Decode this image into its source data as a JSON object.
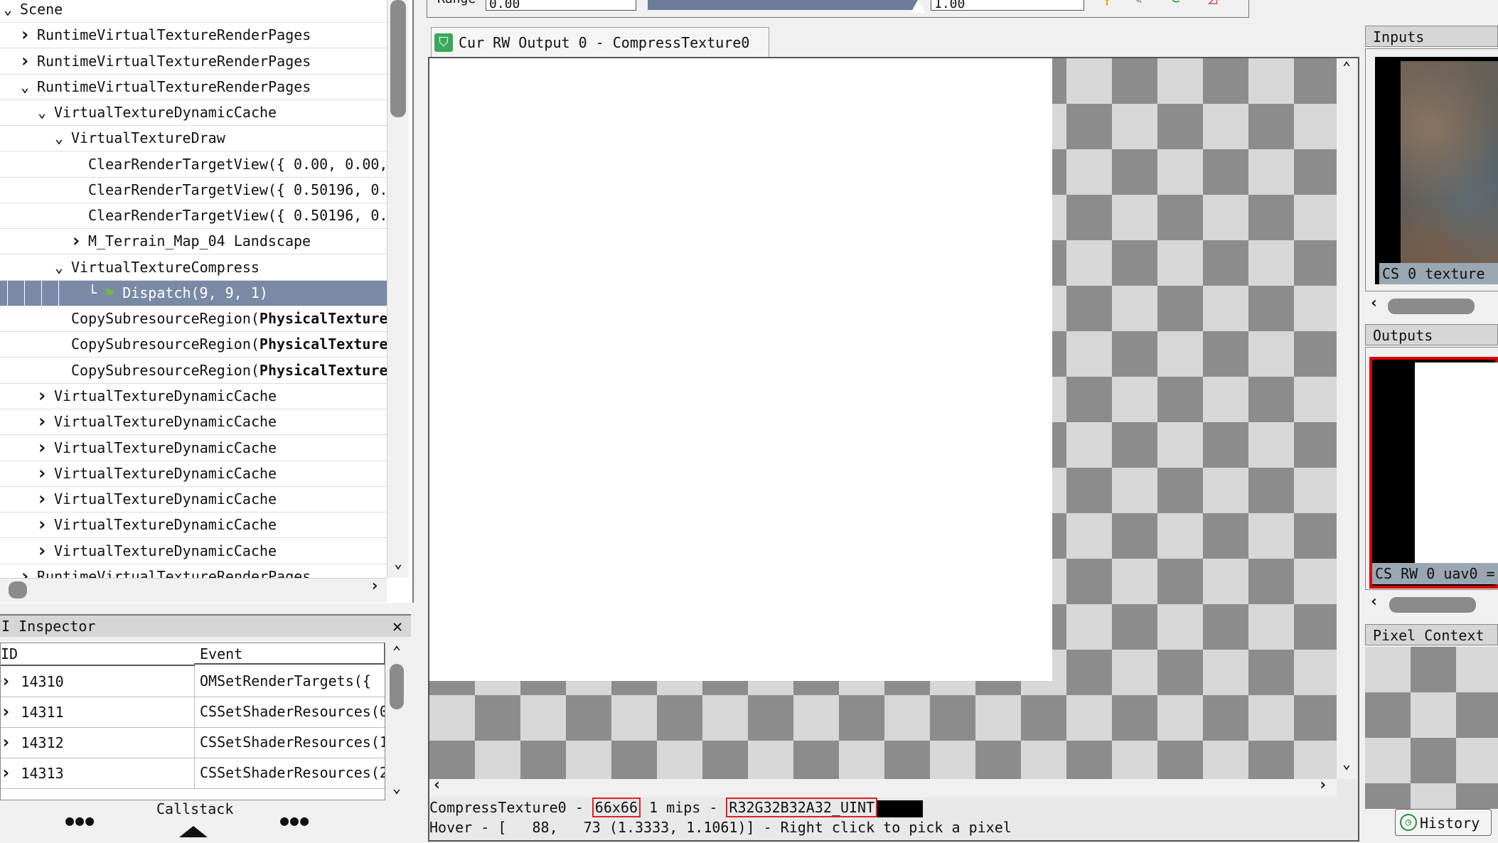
{
  "event_tree": {
    "rows": [
      {
        "indent": 0,
        "arrow": "v",
        "label": "Scene"
      },
      {
        "indent": 1,
        "arrow": ">",
        "label": "RuntimeVirtualTextureRenderPages"
      },
      {
        "indent": 1,
        "arrow": ">",
        "label": "RuntimeVirtualTextureRenderPages"
      },
      {
        "indent": 1,
        "arrow": "v",
        "label": "RuntimeVirtualTextureRenderPages"
      },
      {
        "indent": 2,
        "arrow": "v",
        "label": "VirtualTextureDynamicCache"
      },
      {
        "indent": 3,
        "arrow": "v",
        "label": "VirtualTextureDraw"
      },
      {
        "indent": 4,
        "arrow": "",
        "label": "ClearRenderTargetView({ 0.00, 0.00,"
      },
      {
        "indent": 4,
        "arrow": "",
        "label": "ClearRenderTargetView({ 0.50196, 0."
      },
      {
        "indent": 4,
        "arrow": "",
        "label": "ClearRenderTargetView({ 0.50196, 0."
      },
      {
        "indent": 4,
        "arrow": ">",
        "label": "M_Terrain_Map_04 Landscape"
      },
      {
        "indent": 3,
        "arrow": "v",
        "label": "VirtualTextureCompress"
      },
      {
        "indent": 4,
        "arrow": "",
        "label": "Dispatch(9, 9, 1)",
        "selected": true
      },
      {
        "indent": 3,
        "arrow": "",
        "label": "CopySubresourceRegion(",
        "bold": "PhysicalTexture"
      },
      {
        "indent": 3,
        "arrow": "",
        "label": "CopySubresourceRegion(",
        "bold": "PhysicalTexture"
      },
      {
        "indent": 3,
        "arrow": "",
        "label": "CopySubresourceRegion(",
        "bold": "PhysicalTexture"
      },
      {
        "indent": 2,
        "arrow": ">",
        "label": "VirtualTextureDynamicCache"
      },
      {
        "indent": 2,
        "arrow": ">",
        "label": "VirtualTextureDynamicCache"
      },
      {
        "indent": 2,
        "arrow": ">",
        "label": "VirtualTextureDynamicCache"
      },
      {
        "indent": 2,
        "arrow": ">",
        "label": "VirtualTextureDynamicCache"
      },
      {
        "indent": 2,
        "arrow": ">",
        "label": "VirtualTextureDynamicCache"
      },
      {
        "indent": 2,
        "arrow": ">",
        "label": "VirtualTextureDynamicCache"
      },
      {
        "indent": 2,
        "arrow": ">",
        "label": "VirtualTextureDynamicCache"
      },
      {
        "indent": 1,
        "arrow": ">",
        "label": "RuntimeVirtualTextureRenderPages"
      }
    ]
  },
  "inspector": {
    "title": "I Inspector",
    "col_id": "ID",
    "col_event": "Event",
    "rows": [
      {
        "id": "14310",
        "event": "OMSetRenderTargets({"
      },
      {
        "id": "14311",
        "event": "CSSetShaderResources(0"
      },
      {
        "id": "14312",
        "event": "CSSetShaderResources(1"
      },
      {
        "id": "14313",
        "event": "CSSetShaderResources(2"
      }
    ],
    "callstack_label": "Callstack",
    "dots": "●●●"
  },
  "toolbar": {
    "range_label": "Range",
    "range_min": "0.00",
    "range_max": "1.00"
  },
  "viewer": {
    "tab_label": "Cur RW Output 0 - CompressTexture0",
    "status_name": "CompressTexture0 - ",
    "status_size": "66x66",
    "status_mips": " 1 mips - ",
    "status_format": "R32G32B32A32_UINT",
    "hover_text": "Hover - [   88,   73 (1.3333, 1.1061)] - Right click to pick a pixel"
  },
  "right_panel": {
    "inputs_title": "Inputs",
    "inputs_thumb_label": "CS 0   texture",
    "outputs_title": "Outputs",
    "outputs_thumb_label": "CS RW 0  uav0 =",
    "pixel_context_title": "Pixel Context",
    "history_label": "History"
  },
  "colors": {
    "selection": "#7a8aa6",
    "highlight": "#e02020",
    "flag": "#7ab83a"
  }
}
